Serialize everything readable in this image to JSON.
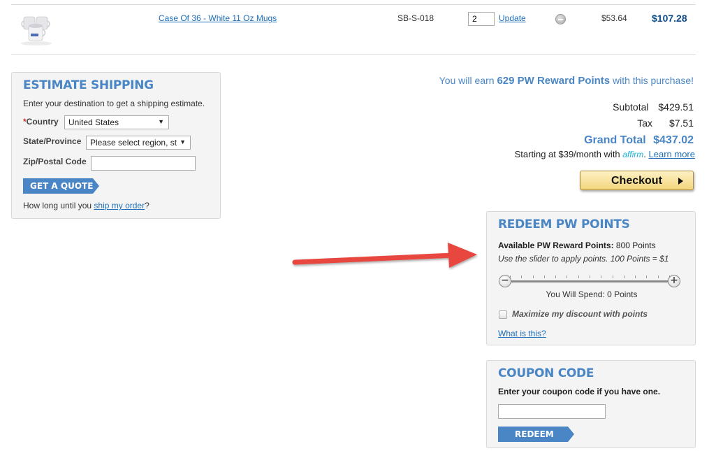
{
  "cart_item": {
    "image_alt": "white-mugs-thumbnail",
    "name": "Case Of 36 - White 11 Oz Mugs",
    "sku": "SB-S-018",
    "quantity": "2",
    "update_label": "Update",
    "unit_price": "$53.64",
    "row_total": "$107.28"
  },
  "estimate_shipping": {
    "title": "ESTIMATE SHIPPING",
    "description": "Enter your destination to get a shipping estimate.",
    "country_required_mark": "*",
    "country_label": "Country",
    "country_value": "United States",
    "state_label": "State/Province",
    "state_value": "Please select region, st",
    "zip_label": "Zip/Postal Code",
    "zip_value": "",
    "quote_button": "GET A QUOTE",
    "note_prefix": "How long until you ",
    "note_link": "ship my order",
    "note_suffix": "?"
  },
  "totals": {
    "earn_prefix": "You will earn ",
    "earn_points": "629 PW Reward Points",
    "earn_suffix": " with this purchase!",
    "subtotal_label": "Subtotal",
    "subtotal_value": "$429.51",
    "tax_label": "Tax",
    "tax_value": "$7.51",
    "grand_total_label": "Grand Total",
    "grand_total_value": "$437.02",
    "affirm_prefix": "Starting at $39/month with ",
    "affirm_logo": "affirm",
    "affirm_suffix": ". ",
    "learn_more": "Learn more",
    "checkout_label": "Checkout"
  },
  "redeem_points": {
    "title": "REDEEM PW POINTS",
    "available_label": "Available PW Reward Points:",
    "available_value": " 800 Points",
    "hint": "Use the slider to apply points. 100 Points = $1",
    "slider_value": 0,
    "slider_max": 800,
    "minus": "−",
    "plus": "+",
    "spend_text": "You Will Spend: 0 Points",
    "maximize_label": "Maximize my discount with points",
    "maximize_checked": false,
    "what_is_this": "What is this?"
  },
  "coupon": {
    "title": "COUPON CODE",
    "description": "Enter your coupon code if you have one.",
    "code_value": "",
    "redeem_button": "REDEEM"
  },
  "annotation": {
    "arrow_color": "#e8463f"
  }
}
